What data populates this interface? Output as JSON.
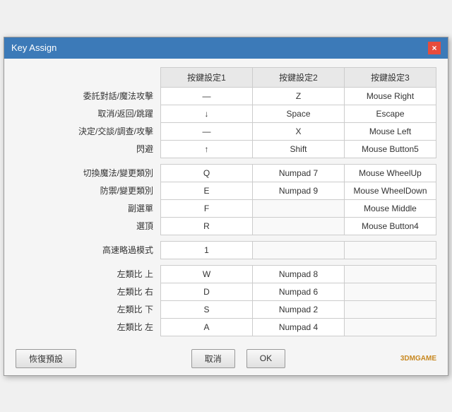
{
  "window": {
    "title": "Key Assign",
    "close_label": "×"
  },
  "table": {
    "col_headers": [
      "按鍵設定1",
      "按鍵設定2",
      "按鍵設定3"
    ],
    "rows": [
      {
        "label": "委託對話/魔法攻擊",
        "k1": "—",
        "k2": "Z",
        "k3": "Mouse Right"
      },
      {
        "label": "取消/返回/跳躍",
        "k1": "↓",
        "k2": "Space",
        "k3": "Escape"
      },
      {
        "label": "決定/交談/調查/攻擊",
        "k1": "—",
        "k2": "X",
        "k3": "Mouse Left"
      },
      {
        "label": "閃避",
        "k1": "↑",
        "k2": "Shift",
        "k3": "Mouse Button5"
      }
    ],
    "rows2": [
      {
        "label": "切換魔法/變更類別",
        "k1": "Q",
        "k2": "Numpad 7",
        "k3": "Mouse WheelUp"
      },
      {
        "label": "防禦/變更類別",
        "k1": "E",
        "k2": "Numpad 9",
        "k3": "Mouse WheelDown"
      },
      {
        "label": "副選單",
        "k1": "F",
        "k2": "",
        "k3": "Mouse Middle"
      },
      {
        "label": "選頂",
        "k1": "R",
        "k2": "",
        "k3": "Mouse Button4"
      }
    ],
    "rows3": [
      {
        "label": "高速略過模式",
        "k1": "1",
        "k2": "",
        "k3": ""
      }
    ],
    "rows4": [
      {
        "label": "左類比 上",
        "k1": "W",
        "k2": "Numpad 8",
        "k3": ""
      },
      {
        "label": "左類比 右",
        "k1": "D",
        "k2": "Numpad 6",
        "k3": ""
      },
      {
        "label": "左類比 下",
        "k1": "S",
        "k2": "Numpad 2",
        "k3": ""
      },
      {
        "label": "左類比 左",
        "k1": "A",
        "k2": "Numpad 4",
        "k3": ""
      }
    ]
  },
  "footer": {
    "reset_label": "恢復預設",
    "cancel_label": "取消",
    "ok_label": "OK",
    "watermark": "3DMGAME"
  }
}
